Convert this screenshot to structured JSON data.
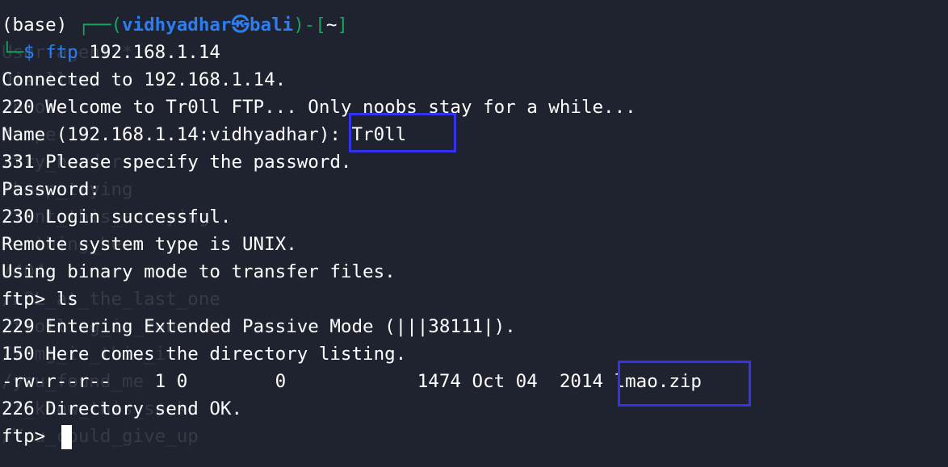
{
  "terminal": {
    "prompt": {
      "env": "(base) ",
      "decor_top_left": "┌──(",
      "user": "vidhyadhar",
      "at_symbol": "㉿",
      "host": "bali",
      "decor_mid": ")-[",
      "cwd": "~",
      "decor_end": "]",
      "decor_bottom": "└─",
      "dollar": "$ ",
      "command": "ftp",
      "command_args": " 192.168.1.14"
    },
    "lines": [
      "Connected to 192.168.1.14.",
      "220 Welcome to Tr0ll FTP... Only noobs stay for a while...",
      "Name (192.168.1.14:vidhyadhar): Tr0ll",
      "331 Please specify the password.",
      "Password:",
      "230 Login successful.",
      "Remote system type is UNIX.",
      "Using binary mode to transfer files.",
      "ftp> ls",
      "229 Entering Extended Passive Mode (|||38111|).",
      "150 Here comes the directory listing.",
      "-rw-r--r--    1 0        0            1474 Oct 04  2014 lmao.zip",
      "226 Directory send OK.",
      "ftp> "
    ],
    "background_ghost_lines": [
      "User-agent:*",
      "Disallow:",
      "/noob",
      "/nope",
      "/try_harder",
      "/keep_trying",
      "/isnt_this_annoying",
      "/nothing_here",
      "/404",
      "/LOL_at_the_last_one",
      "/trolling_is_fun",
      "/zomg_is_this_it",
      "/you_found_me",
      "/I_know_this_sucks",
      "/You_could_give_up"
    ]
  },
  "colors": {
    "background": "#1f2330",
    "text": "#ffffff",
    "ghost_text": "#353a47",
    "prompt_decor": "#19a35f",
    "prompt_user": "#2d7dee",
    "highlight_box": "#3333ee"
  }
}
